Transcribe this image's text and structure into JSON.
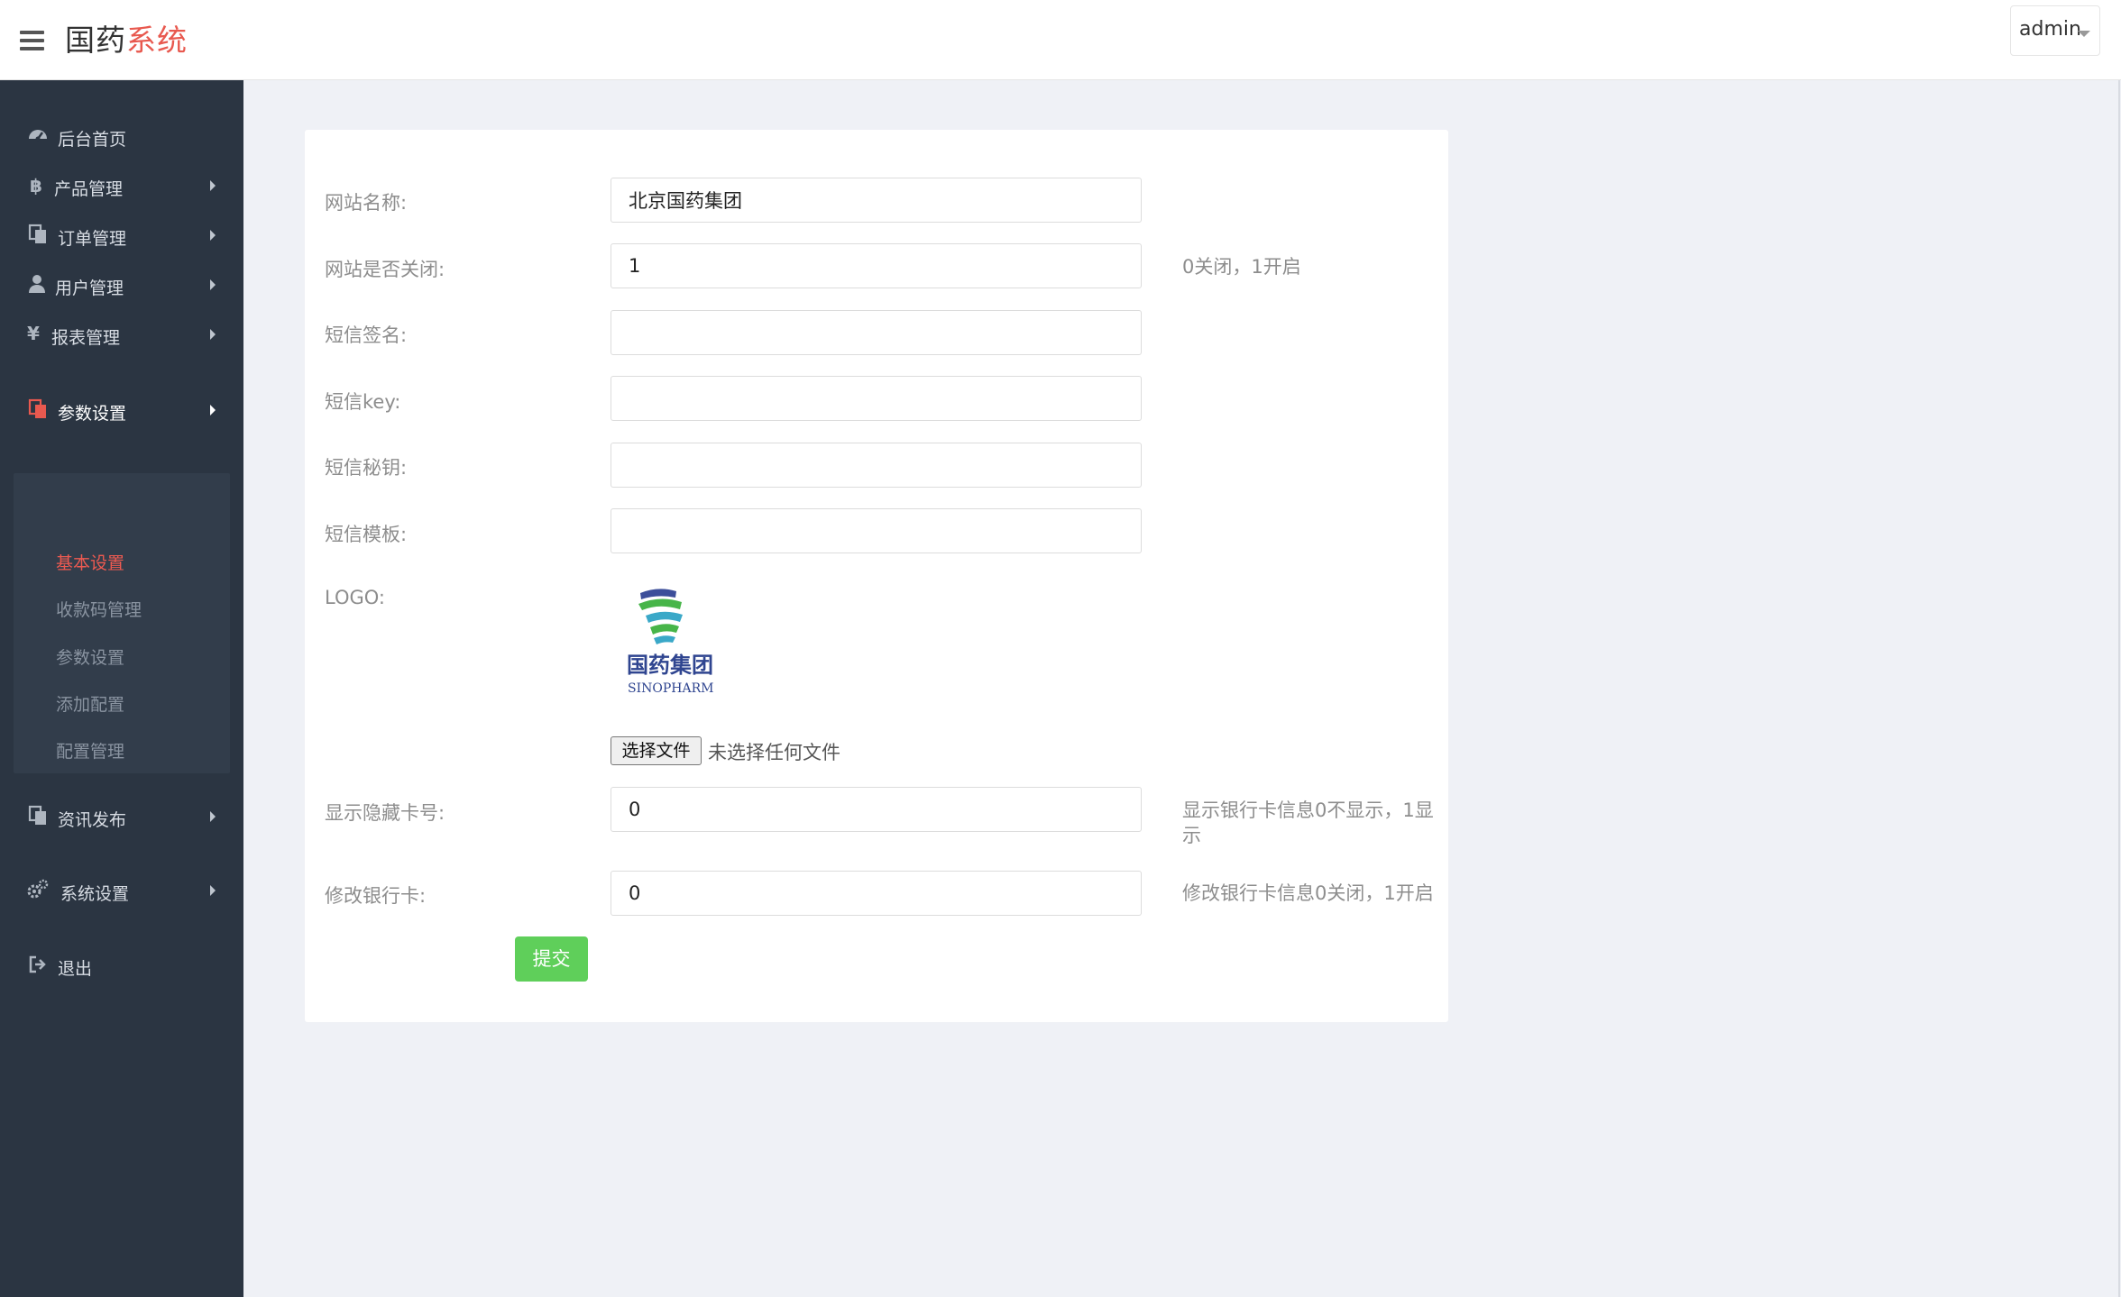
{
  "header": {
    "brand_main": "国药",
    "brand_accent": "系统",
    "user_name": "admin"
  },
  "sidebar": {
    "items": [
      {
        "label": "后台首页",
        "icon": "dashboard-icon",
        "has_arrow": false
      },
      {
        "label": "产品管理",
        "icon": "bitcoin-icon",
        "has_arrow": true
      },
      {
        "label": "订单管理",
        "icon": "copy-icon",
        "has_arrow": true
      },
      {
        "label": "用户管理",
        "icon": "user-icon",
        "has_arrow": true
      },
      {
        "label": "报表管理",
        "icon": "yen-icon",
        "has_arrow": true
      },
      {
        "label": "参数设置",
        "icon": "copy-icon",
        "has_arrow": true,
        "active": true
      },
      {
        "label": "资讯发布",
        "icon": "copy-icon",
        "has_arrow": true
      },
      {
        "label": "系统设置",
        "icon": "gears-icon",
        "has_arrow": true
      },
      {
        "label": "退出",
        "icon": "sign-out-icon",
        "has_arrow": false
      }
    ],
    "submenu": [
      {
        "label": "基本设置",
        "current": true
      },
      {
        "label": "收款码管理"
      },
      {
        "label": "参数设置"
      },
      {
        "label": "添加配置"
      },
      {
        "label": "配置管理"
      }
    ]
  },
  "form": {
    "site_name": {
      "label": "网站名称:",
      "value": "北京国药集团"
    },
    "site_closed": {
      "label": "网站是否关闭:",
      "value": "1",
      "hint": "0关闭，1开启"
    },
    "sms_sign": {
      "label": "短信签名:",
      "value": ""
    },
    "sms_key": {
      "label": "短信key:",
      "value": ""
    },
    "sms_secret": {
      "label": "短信秘钥:",
      "value": ""
    },
    "sms_template": {
      "label": "短信模板:",
      "value": ""
    },
    "logo": {
      "label": "LOGO:",
      "image_text_cn": "国药集团",
      "image_text_en": "SINOPHARM",
      "file_button": "选择文件",
      "file_status": "未选择任何文件"
    },
    "hide_card": {
      "label": "显示隐藏卡号:",
      "value": "0",
      "hint_line1": "显示银行卡信息0不显示，1显",
      "hint_line2": "示"
    },
    "edit_card": {
      "label": "修改银行卡:",
      "value": "0",
      "hint": "修改银行卡信息0关闭，1开启"
    },
    "submit_label": "提交"
  },
  "colors": {
    "sidebar_bg": "#2b3542",
    "accent_red": "#e8594f",
    "submit_green": "#5fcf5a",
    "page_bg": "#eff1f6"
  }
}
